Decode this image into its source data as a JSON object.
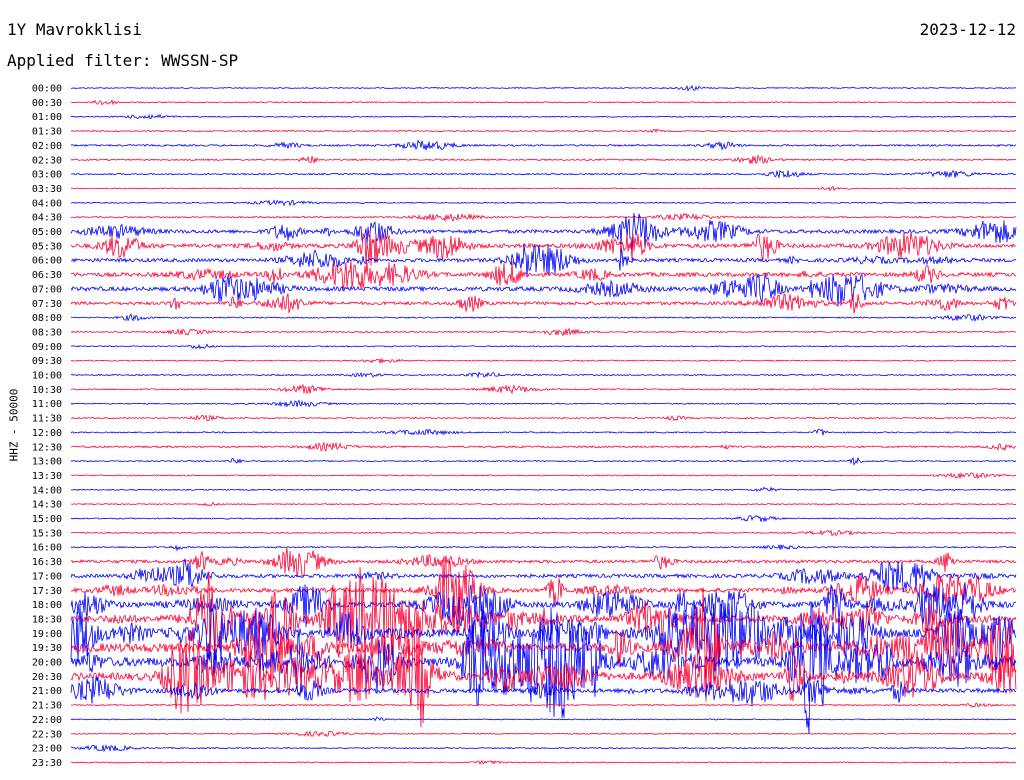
{
  "header": {
    "station": "1Y Mavrokklisi",
    "date": "2023-12-12",
    "filter": "Applied filter: WWSSN-SP"
  },
  "chart_data": {
    "type": "line",
    "ylabel": "HHZ - 50000",
    "row_colors": [
      "#0000ff",
      "#ff0033"
    ],
    "x_start": "00:00",
    "row_interval": "30 min",
    "row_labels": [
      "00:00",
      "00:30",
      "01:00",
      "01:30",
      "02:00",
      "02:30",
      "03:00",
      "03:30",
      "04:00",
      "04:30",
      "05:00",
      "05:30",
      "06:00",
      "06:30",
      "07:00",
      "07:30",
      "08:00",
      "08:30",
      "09:00",
      "09:30",
      "10:00",
      "10:30",
      "11:00",
      "11:30",
      "12:00",
      "12:30",
      "13:00",
      "13:30",
      "14:00",
      "14:30",
      "15:00",
      "15:30",
      "16:00",
      "16:30",
      "17:00",
      "17:30",
      "18:00",
      "18:30",
      "19:00",
      "19:30",
      "20:00",
      "20:30",
      "21:00",
      "21:30",
      "22:00",
      "22:30",
      "23:00",
      "23:30"
    ],
    "activity": [
      0.3,
      0.4,
      0.3,
      0.4,
      0.9,
      0.7,
      0.6,
      0.2,
      0.3,
      0.6,
      2.6,
      3.0,
      2.6,
      3.0,
      3.2,
      2.2,
      0.5,
      0.5,
      0.4,
      0.4,
      0.5,
      0.6,
      0.4,
      0.5,
      0.5,
      0.9,
      0.5,
      0.4,
      0.4,
      0.4,
      0.4,
      0.4,
      0.6,
      2.2,
      2.6,
      3.2,
      4.6,
      5.8,
      6.6,
      7.2,
      7.6,
      5.8,
      3.2,
      0.4,
      0.3,
      0.3,
      0.4,
      0.3
    ],
    "grid": false
  }
}
